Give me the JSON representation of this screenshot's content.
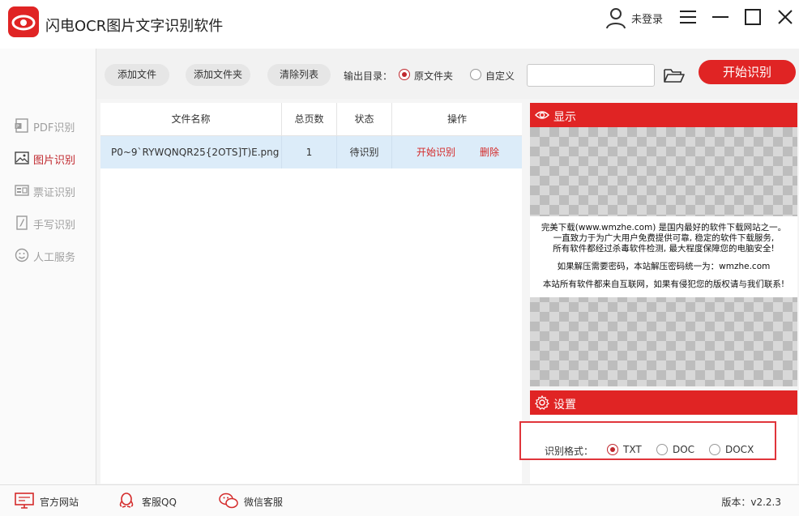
{
  "app": {
    "title": "闪电OCR图片文字识别软件",
    "login_text": "未登录"
  },
  "colors": {
    "accent": "#e02424",
    "selected_row": "#dcecf9"
  },
  "sidebar": {
    "items": [
      {
        "label": "PDF识别",
        "icon": "pdf-icon",
        "active": false
      },
      {
        "label": "图片识别",
        "icon": "image-icon",
        "active": true
      },
      {
        "label": "票证识别",
        "icon": "card-icon",
        "active": false
      },
      {
        "label": "手写识别",
        "icon": "handwriting-icon",
        "active": false
      },
      {
        "label": "人工服务",
        "icon": "smiley-icon",
        "active": false
      }
    ]
  },
  "toolbar": {
    "add_file": "添加文件",
    "add_folder": "添加文件夹",
    "clear_list": "清除列表",
    "output_label": "输出目录：",
    "option_original": "原文件夹",
    "option_custom": "自定义",
    "output_selected": "原文件夹",
    "path_value": "",
    "start_button": "开始识别"
  },
  "table": {
    "headers": [
      "文件名称",
      "总页数",
      "状态",
      "操作"
    ],
    "rows": [
      {
        "file_name": "P0~9`RYWQNQR25{2OTS]T)E.png",
        "pages": "1",
        "status": "待识别",
        "action_start": "开始识别",
        "action_delete": "删除"
      }
    ]
  },
  "preview": {
    "title": "显示",
    "lines": [
      "完美下载(www.wmzhe.com) 是国内最好的软件下载网站之一。",
      "一直致力于为广大用户免费提供可靠, 稳定的软件下载服务,",
      "所有软件都经过杀毒软件检测, 最大程度保障您的电脑安全!",
      "如果解压需要密码，本站解压密码统一为：wmzhe.com",
      "本站所有软件都来自互联网，如果有侵犯您的版权请与我们联系!"
    ]
  },
  "settings": {
    "title": "设置",
    "format_label": "识别格式：",
    "formats": [
      "TXT",
      "DOC",
      "DOCX"
    ],
    "selected_format": "TXT"
  },
  "footer": {
    "website": "官方网站",
    "qq": "客服QQ",
    "wechat": "微信客服",
    "version": "版本：v2.2.3"
  }
}
